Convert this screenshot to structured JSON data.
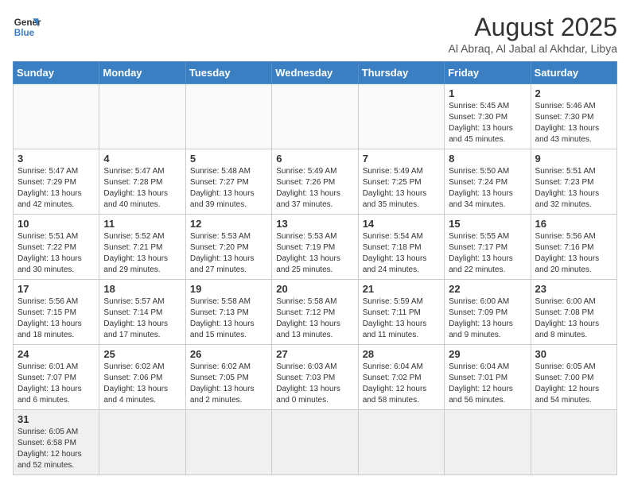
{
  "header": {
    "logo_text_regular": "General",
    "logo_text_bold": "Blue",
    "month_year": "August 2025",
    "location": "Al Abraq, Al Jabal al Akhdar, Libya"
  },
  "days_of_week": [
    "Sunday",
    "Monday",
    "Tuesday",
    "Wednesday",
    "Thursday",
    "Friday",
    "Saturday"
  ],
  "weeks": [
    [
      {
        "day": "",
        "sunrise": "",
        "sunset": "",
        "daylight": ""
      },
      {
        "day": "",
        "sunrise": "",
        "sunset": "",
        "daylight": ""
      },
      {
        "day": "",
        "sunrise": "",
        "sunset": "",
        "daylight": ""
      },
      {
        "day": "",
        "sunrise": "",
        "sunset": "",
        "daylight": ""
      },
      {
        "day": "",
        "sunrise": "",
        "sunset": "",
        "daylight": ""
      },
      {
        "day": "1",
        "sunrise": "Sunrise: 5:45 AM",
        "sunset": "Sunset: 7:30 PM",
        "daylight": "Daylight: 13 hours and 45 minutes."
      },
      {
        "day": "2",
        "sunrise": "Sunrise: 5:46 AM",
        "sunset": "Sunset: 7:30 PM",
        "daylight": "Daylight: 13 hours and 43 minutes."
      }
    ],
    [
      {
        "day": "3",
        "sunrise": "Sunrise: 5:47 AM",
        "sunset": "Sunset: 7:29 PM",
        "daylight": "Daylight: 13 hours and 42 minutes."
      },
      {
        "day": "4",
        "sunrise": "Sunrise: 5:47 AM",
        "sunset": "Sunset: 7:28 PM",
        "daylight": "Daylight: 13 hours and 40 minutes."
      },
      {
        "day": "5",
        "sunrise": "Sunrise: 5:48 AM",
        "sunset": "Sunset: 7:27 PM",
        "daylight": "Daylight: 13 hours and 39 minutes."
      },
      {
        "day": "6",
        "sunrise": "Sunrise: 5:49 AM",
        "sunset": "Sunset: 7:26 PM",
        "daylight": "Daylight: 13 hours and 37 minutes."
      },
      {
        "day": "7",
        "sunrise": "Sunrise: 5:49 AM",
        "sunset": "Sunset: 7:25 PM",
        "daylight": "Daylight: 13 hours and 35 minutes."
      },
      {
        "day": "8",
        "sunrise": "Sunrise: 5:50 AM",
        "sunset": "Sunset: 7:24 PM",
        "daylight": "Daylight: 13 hours and 34 minutes."
      },
      {
        "day": "9",
        "sunrise": "Sunrise: 5:51 AM",
        "sunset": "Sunset: 7:23 PM",
        "daylight": "Daylight: 13 hours and 32 minutes."
      }
    ],
    [
      {
        "day": "10",
        "sunrise": "Sunrise: 5:51 AM",
        "sunset": "Sunset: 7:22 PM",
        "daylight": "Daylight: 13 hours and 30 minutes."
      },
      {
        "day": "11",
        "sunrise": "Sunrise: 5:52 AM",
        "sunset": "Sunset: 7:21 PM",
        "daylight": "Daylight: 13 hours and 29 minutes."
      },
      {
        "day": "12",
        "sunrise": "Sunrise: 5:53 AM",
        "sunset": "Sunset: 7:20 PM",
        "daylight": "Daylight: 13 hours and 27 minutes."
      },
      {
        "day": "13",
        "sunrise": "Sunrise: 5:53 AM",
        "sunset": "Sunset: 7:19 PM",
        "daylight": "Daylight: 13 hours and 25 minutes."
      },
      {
        "day": "14",
        "sunrise": "Sunrise: 5:54 AM",
        "sunset": "Sunset: 7:18 PM",
        "daylight": "Daylight: 13 hours and 24 minutes."
      },
      {
        "day": "15",
        "sunrise": "Sunrise: 5:55 AM",
        "sunset": "Sunset: 7:17 PM",
        "daylight": "Daylight: 13 hours and 22 minutes."
      },
      {
        "day": "16",
        "sunrise": "Sunrise: 5:56 AM",
        "sunset": "Sunset: 7:16 PM",
        "daylight": "Daylight: 13 hours and 20 minutes."
      }
    ],
    [
      {
        "day": "17",
        "sunrise": "Sunrise: 5:56 AM",
        "sunset": "Sunset: 7:15 PM",
        "daylight": "Daylight: 13 hours and 18 minutes."
      },
      {
        "day": "18",
        "sunrise": "Sunrise: 5:57 AM",
        "sunset": "Sunset: 7:14 PM",
        "daylight": "Daylight: 13 hours and 17 minutes."
      },
      {
        "day": "19",
        "sunrise": "Sunrise: 5:58 AM",
        "sunset": "Sunset: 7:13 PM",
        "daylight": "Daylight: 13 hours and 15 minutes."
      },
      {
        "day": "20",
        "sunrise": "Sunrise: 5:58 AM",
        "sunset": "Sunset: 7:12 PM",
        "daylight": "Daylight: 13 hours and 13 minutes."
      },
      {
        "day": "21",
        "sunrise": "Sunrise: 5:59 AM",
        "sunset": "Sunset: 7:11 PM",
        "daylight": "Daylight: 13 hours and 11 minutes."
      },
      {
        "day": "22",
        "sunrise": "Sunrise: 6:00 AM",
        "sunset": "Sunset: 7:09 PM",
        "daylight": "Daylight: 13 hours and 9 minutes."
      },
      {
        "day": "23",
        "sunrise": "Sunrise: 6:00 AM",
        "sunset": "Sunset: 7:08 PM",
        "daylight": "Daylight: 13 hours and 8 minutes."
      }
    ],
    [
      {
        "day": "24",
        "sunrise": "Sunrise: 6:01 AM",
        "sunset": "Sunset: 7:07 PM",
        "daylight": "Daylight: 13 hours and 6 minutes."
      },
      {
        "day": "25",
        "sunrise": "Sunrise: 6:02 AM",
        "sunset": "Sunset: 7:06 PM",
        "daylight": "Daylight: 13 hours and 4 minutes."
      },
      {
        "day": "26",
        "sunrise": "Sunrise: 6:02 AM",
        "sunset": "Sunset: 7:05 PM",
        "daylight": "Daylight: 13 hours and 2 minutes."
      },
      {
        "day": "27",
        "sunrise": "Sunrise: 6:03 AM",
        "sunset": "Sunset: 7:03 PM",
        "daylight": "Daylight: 13 hours and 0 minutes."
      },
      {
        "day": "28",
        "sunrise": "Sunrise: 6:04 AM",
        "sunset": "Sunset: 7:02 PM",
        "daylight": "Daylight: 12 hours and 58 minutes."
      },
      {
        "day": "29",
        "sunrise": "Sunrise: 6:04 AM",
        "sunset": "Sunset: 7:01 PM",
        "daylight": "Daylight: 12 hours and 56 minutes."
      },
      {
        "day": "30",
        "sunrise": "Sunrise: 6:05 AM",
        "sunset": "Sunset: 7:00 PM",
        "daylight": "Daylight: 12 hours and 54 minutes."
      }
    ],
    [
      {
        "day": "31",
        "sunrise": "Sunrise: 6:05 AM",
        "sunset": "Sunset: 6:58 PM",
        "daylight": "Daylight: 12 hours and 52 minutes."
      },
      {
        "day": "",
        "sunrise": "",
        "sunset": "",
        "daylight": ""
      },
      {
        "day": "",
        "sunrise": "",
        "sunset": "",
        "daylight": ""
      },
      {
        "day": "",
        "sunrise": "",
        "sunset": "",
        "daylight": ""
      },
      {
        "day": "",
        "sunrise": "",
        "sunset": "",
        "daylight": ""
      },
      {
        "day": "",
        "sunrise": "",
        "sunset": "",
        "daylight": ""
      },
      {
        "day": "",
        "sunrise": "",
        "sunset": "",
        "daylight": ""
      }
    ]
  ]
}
